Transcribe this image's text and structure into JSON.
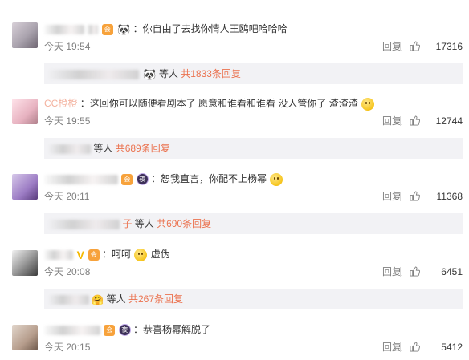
{
  "comments": [
    {
      "text": "：你自由了去找你情人王鸥吧哈哈哈",
      "time": "今天 19:54",
      "reply": "回复",
      "likes": "17316",
      "sub_suffix": "等人",
      "sub_more": "共1833条回复"
    },
    {
      "name_visible": "CC橙橙",
      "text": "：这回你可以随便看剧本了 愿意和谁看和谁看 没人管你了 渣渣渣",
      "time": "今天 19:55",
      "reply": "回复",
      "likes": "12744",
      "sub_suffix": "等人",
      "sub_more": "共689条回复"
    },
    {
      "text": "：恕我直言，你配不上杨幂",
      "time": "今天 20:11",
      "reply": "回复",
      "likes": "11368",
      "sub_name_tail": "子",
      "sub_suffix": "等人",
      "sub_more": "共690条回复"
    },
    {
      "text_a": "：呵呵",
      "text_b": "虚伪",
      "time": "今天 20:08",
      "reply": "回复",
      "likes": "6451",
      "sub_suffix": "等人",
      "sub_more": "共267条回复"
    },
    {
      "text": "：恭喜杨幂解脱了",
      "time": "今天 20:15",
      "reply": "回复",
      "likes": "5412"
    }
  ],
  "colors": {
    "username": "#eb7350",
    "more_link": "#eb7350",
    "meta_gray": "#808080",
    "sub_bg": "#f2f2f5"
  },
  "icons": {
    "like": "thumb-up-icon",
    "panda": "panda-emoji-icon",
    "member_badge": "vip-badge-icon",
    "night_badge": "ye-badge-icon"
  }
}
